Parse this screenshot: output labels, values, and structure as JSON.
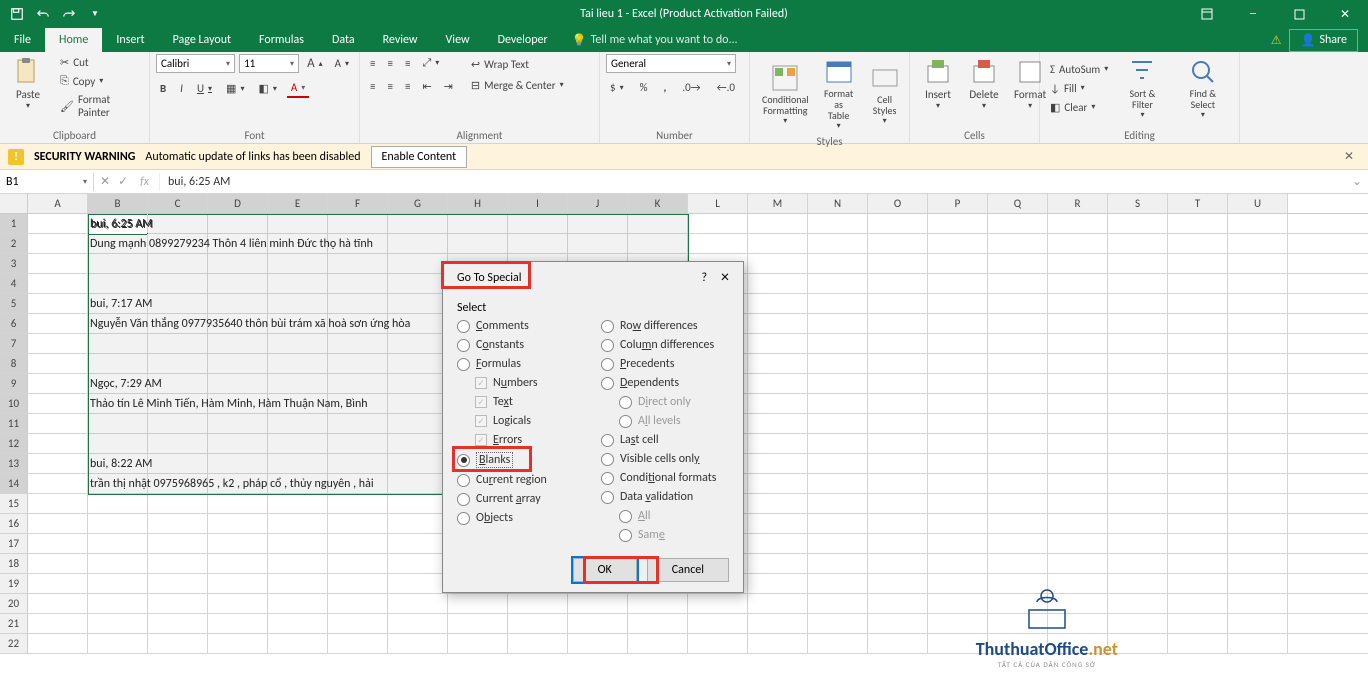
{
  "title": "Tai lieu 1 - Excel (Product Activation Failed)",
  "tabs": {
    "file": "File",
    "home": "Home",
    "insert": "Insert",
    "page": "Page Layout",
    "formulas": "Formulas",
    "data": "Data",
    "review": "Review",
    "view": "View",
    "developer": "Developer",
    "tell": "Tell me what you want to do..."
  },
  "share": "Share",
  "clipboard": {
    "label": "Clipboard",
    "paste": "Paste",
    "cut": "Cut",
    "copy": "Copy",
    "fp": "Format Painter"
  },
  "font": {
    "label": "Font",
    "name": "Calibri",
    "size": "11"
  },
  "align": {
    "label": "Alignment",
    "wrap": "Wrap Text",
    "merge": "Merge & Center"
  },
  "num": {
    "label": "Number",
    "format": "General"
  },
  "styles": {
    "label": "Styles",
    "cf": "Conditional Formatting",
    "fat": "Format as Table",
    "cs": "Cell Styles"
  },
  "cells": {
    "label": "Cells",
    "ins": "Insert",
    "del": "Delete",
    "fmt": "Format"
  },
  "editing": {
    "label": "Editing",
    "sum": "AutoSum",
    "fill": "Fill",
    "clear": "Clear",
    "sort": "Sort & Filter",
    "find": "Find & Select"
  },
  "warning": {
    "title": "SECURITY WARNING",
    "msg": "Automatic update of links has been disabled",
    "btn": "Enable Content"
  },
  "namebox": "B1",
  "formula_bar": "bui, 6:25 AM",
  "columns": [
    "A",
    "B",
    "C",
    "D",
    "E",
    "F",
    "G",
    "H",
    "I",
    "J",
    "K",
    "L",
    "M",
    "N",
    "O",
    "P",
    "Q",
    "R",
    "S",
    "T",
    "U"
  ],
  "row_count": 22,
  "selected_rows": [
    1,
    2,
    3,
    4,
    5,
    6,
    7,
    8,
    9,
    10,
    11,
    12,
    13,
    14
  ],
  "cell_data": {
    "B1": "bui, 6:25 AM",
    "B2": "Dung mạnh 0899279234 Thôn 4 liên minh Đức thọ hà tĩnh",
    "B5": "bui, 7:17 AM",
    "B6": "Nguyễn Văn thắng 0977935640 thôn bùi trám xã hoà sơn ứng hòa",
    "B9": "Ngọc, 7:29 AM",
    "B10": "Thảo tín Lê Minh Tiến, Hàm Minh, Hàm Thuận Nam, Bình",
    "B13": "bui, 8:22 AM",
    "B14": "trần thị nhật  0975968965 , k2 , pháp cổ , thủy nguyên , hải"
  },
  "watermark": {
    "text": "ThuthuatOffice",
    "sub": ".net"
  },
  "dialog": {
    "title": "Go To Special",
    "help": "?",
    "close": "×",
    "select": "Select",
    "left": [
      {
        "label": "Comments",
        "u": "C"
      },
      {
        "label": "Constants",
        "u": "o"
      },
      {
        "label": "Formulas",
        "u": "F"
      },
      {
        "label": "Numbers",
        "u": "u",
        "sub": true,
        "chk": true
      },
      {
        "label": "Text",
        "u": "x",
        "sub": true,
        "chk": true
      },
      {
        "label": "Logicals",
        "u": "g",
        "sub": true,
        "chk": true
      },
      {
        "label": "Errors",
        "u": "E",
        "sub": true,
        "chk": true
      },
      {
        "label": "Blanks",
        "u": "B",
        "selected": true
      },
      {
        "label": "Current region",
        "u": "r"
      },
      {
        "label": "Current array",
        "u": "a"
      },
      {
        "label": "Objects",
        "u": "b"
      }
    ],
    "right": [
      {
        "label": "Row differences",
        "u": "w"
      },
      {
        "label": "Column differences",
        "u": "m"
      },
      {
        "label": "Precedents",
        "u": "P"
      },
      {
        "label": "Dependents",
        "u": "D"
      },
      {
        "label": "Direct only",
        "u": "i",
        "sub": true,
        "dis": true
      },
      {
        "label": "All levels",
        "u": "l",
        "sub": true,
        "dis": true
      },
      {
        "label": "Last cell",
        "u": "s"
      },
      {
        "label": "Visible cells only",
        "u": "y"
      },
      {
        "label": "Conditional formats",
        "u": "t"
      },
      {
        "label": "Data validation",
        "u": "v"
      },
      {
        "label": "All",
        "u": "A",
        "sub": true,
        "dis": true
      },
      {
        "label": "Same",
        "u": "e",
        "sub": true,
        "dis": true
      }
    ],
    "ok": "OK",
    "cancel": "Cancel"
  }
}
